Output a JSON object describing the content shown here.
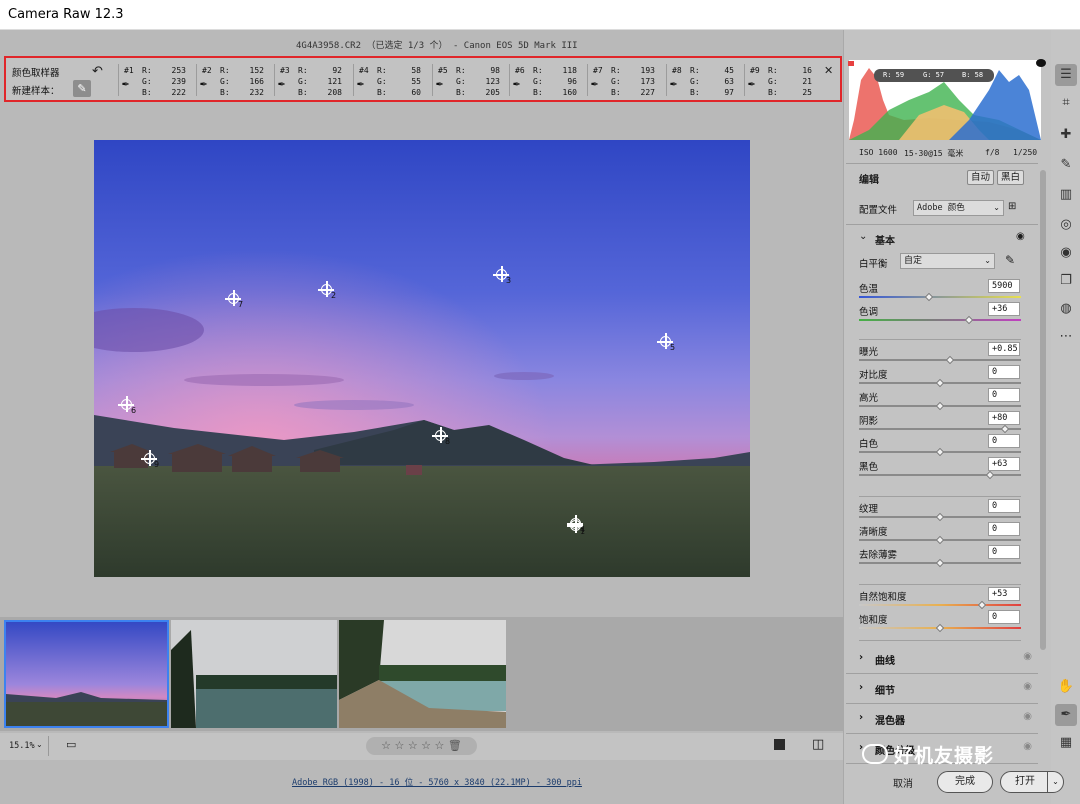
{
  "window": {
    "title": "Camera Raw 12.3"
  },
  "file_info": "4G4A3958.CR2 （已选定 1/3 个） - Canon EOS 5D Mark III",
  "sampler": {
    "label_title": "颜色取样器",
    "label_new": "新建样本：",
    "samples": [
      {
        "num": "#1",
        "r": "253",
        "g": "239",
        "b": "222"
      },
      {
        "num": "#2",
        "r": "152",
        "g": "166",
        "b": "232"
      },
      {
        "num": "#3",
        "r": "92",
        "g": "121",
        "b": "208"
      },
      {
        "num": "#4",
        "r": "58",
        "g": "55",
        "b": "60"
      },
      {
        "num": "#5",
        "r": "98",
        "g": "123",
        "b": "205"
      },
      {
        "num": "#6",
        "r": "118",
        "g": "96",
        "b": "160"
      },
      {
        "num": "#7",
        "r": "193",
        "g": "173",
        "b": "227"
      },
      {
        "num": "#8",
        "r": "45",
        "g": "63",
        "b": "97"
      },
      {
        "num": "#9",
        "r": "16",
        "g": "21",
        "b": "25"
      }
    ],
    "close": "✕"
  },
  "photo_points": [
    "1",
    "2",
    "3",
    "4",
    "5",
    "6",
    "7",
    "8",
    "9"
  ],
  "histogram": {
    "readout": {
      "r": "R: 59",
      "g": "G: 57",
      "b": "B: 58"
    }
  },
  "exif": {
    "iso": "ISO 1600",
    "lens": "15-30@15 毫米",
    "aperture": "f/8",
    "shutter": "1/250"
  },
  "edit": {
    "title": "编辑",
    "auto_btn": "自动",
    "bw_btn": "黑白",
    "profile_label": "配置文件",
    "profile_value": "Adobe 颜色"
  },
  "basic": {
    "title": "基本",
    "wb_label": "白平衡",
    "wb_value": "自定",
    "temp": {
      "label": "色温",
      "value": "5900"
    },
    "tint": {
      "label": "色调",
      "value": "+36"
    },
    "exposure": {
      "label": "曝光",
      "value": "+0.85"
    },
    "contrast": {
      "label": "对比度",
      "value": "0"
    },
    "highlights": {
      "label": "高光",
      "value": "0"
    },
    "shadows": {
      "label": "阴影",
      "value": "+80"
    },
    "whites": {
      "label": "白色",
      "value": "0"
    },
    "blacks": {
      "label": "黑色",
      "value": "+63"
    },
    "texture": {
      "label": "纹理",
      "value": "0"
    },
    "clarity": {
      "label": "清晰度",
      "value": "0"
    },
    "dehaze": {
      "label": "去除薄雾",
      "value": "0"
    },
    "vibrance": {
      "label": "自然饱和度",
      "value": "+53"
    },
    "saturation": {
      "label": "饱和度",
      "value": "0"
    }
  },
  "sections": [
    {
      "label": "曲线"
    },
    {
      "label": "细节"
    },
    {
      "label": "混色器"
    },
    {
      "label": "颜色分级"
    }
  ],
  "bottom": {
    "zoom": "15.1%",
    "color_info": "Adobe RGB (1998) - 16 位 - 5760 x 3840 (22.1MP) - 300 ppi",
    "cancel": "取消",
    "done": "完成",
    "open": "打开"
  },
  "watermark": "好机友摄影"
}
